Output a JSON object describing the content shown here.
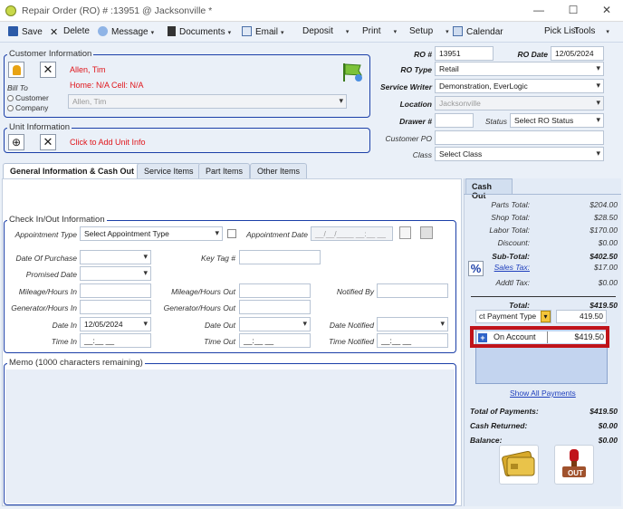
{
  "window": {
    "title": "Repair Order (RO) # :13951 @ Jacksonville *",
    "min": "—",
    "max": "☐",
    "close": "✕"
  },
  "toolbar": {
    "save": "Save",
    "delete": "Delete",
    "message": "Message",
    "documents": "Documents",
    "email": "Email",
    "deposit": "Deposit",
    "print": "Print",
    "setup": "Setup",
    "calendar": "Calendar",
    "pick_list": "Pick List",
    "tools": "Tools"
  },
  "customer": {
    "legend": "Customer Information",
    "name": "Allen, Tim",
    "phones": "Home: N/A Cell: N/A",
    "bill_to_label": "Bill To",
    "opt_customer": "Customer",
    "opt_company": "Company",
    "bill_to_value": "Allen, Tim"
  },
  "unit": {
    "legend": "Unit Information",
    "add_text": "Click to Add Unit Info"
  },
  "ro": {
    "ro_num_label": "RO #",
    "ro_num": "13951",
    "ro_date_label": "RO Date",
    "ro_date": "12/05/2024",
    "ro_type_label": "RO Type",
    "ro_type": "Retail",
    "writer_label": "Service Writer",
    "writer": "Demonstration, EverLogic",
    "location_label": "Location",
    "location": "Jacksonville",
    "drawer_label": "Drawer #",
    "drawer": "",
    "status_label": "Status",
    "status": "Select RO Status",
    "po_label": "Customer PO",
    "po": "",
    "class_label": "Class",
    "class": "Select Class"
  },
  "tabs": [
    "General Information & Cash Out",
    "Service Items",
    "Part Items",
    "Other Items"
  ],
  "checkin": {
    "legend": "Check In/Out Information",
    "appt_type_label": "Appointment Type",
    "appt_type": "Select Appointment Type",
    "appt_date_label": "Appointment Date",
    "appt_date": "__/__/____ __:__ __",
    "purchase_label": "Date Of Purchase",
    "keytag_label": "Key Tag #",
    "promised_label": "Promised Date",
    "mileage_in_label": "Mileage/Hours In",
    "mileage_out_label": "Mileage/Hours Out",
    "notified_by_label": "Notified By",
    "gen_in_label": "Generator/Hours In",
    "gen_out_label": "Generator/Hours Out",
    "date_in_label": "Date In",
    "date_in": "12/05/2024",
    "date_out_label": "Date Out",
    "date_notified_label": "Date Notified",
    "time_in_label": "Time In",
    "time_in": "__:__ __",
    "time_out_label": "Time Out",
    "time_out": "__:__ __",
    "time_notified_label": "Time Notified",
    "time_notified": "__:__ __"
  },
  "memo": {
    "legend": "Memo (1000 characters remaining)"
  },
  "cashout": {
    "tab": "Cash Out",
    "parts_label": "Parts Total:",
    "parts": "$204.00",
    "shop_label": "Shop Total:",
    "shop": "$28.50",
    "labor_label": "Labor Total:",
    "labor": "$170.00",
    "discount_label": "Discount:",
    "discount": "$0.00",
    "subtotal_label": "Sub-Total:",
    "subtotal": "$402.50",
    "salestax_label": "Sales Tax:",
    "salestax": "$17.00",
    "addtl_label": "Addtl Tax:",
    "addtl": "$0.00",
    "total_label": "Total:",
    "total": "$419.50",
    "payment_type": "ct Payment Type",
    "payment_amount": "419.50",
    "pay_row_name": "On Account",
    "pay_row_amount": "$419.50",
    "show_all": "Show All Payments",
    "tot_pay_label": "Total of Payments:",
    "tot_pay": "$419.50",
    "cash_ret_label": "Cash Returned:",
    "cash_ret": "$0.00",
    "balance_label": "Balance:",
    "balance": "$0.00",
    "stamp_text": "OUT"
  },
  "colors": {
    "accent": "#1b3fa8",
    "highlight": "#c0131a",
    "alert_red": "#e0151a"
  }
}
